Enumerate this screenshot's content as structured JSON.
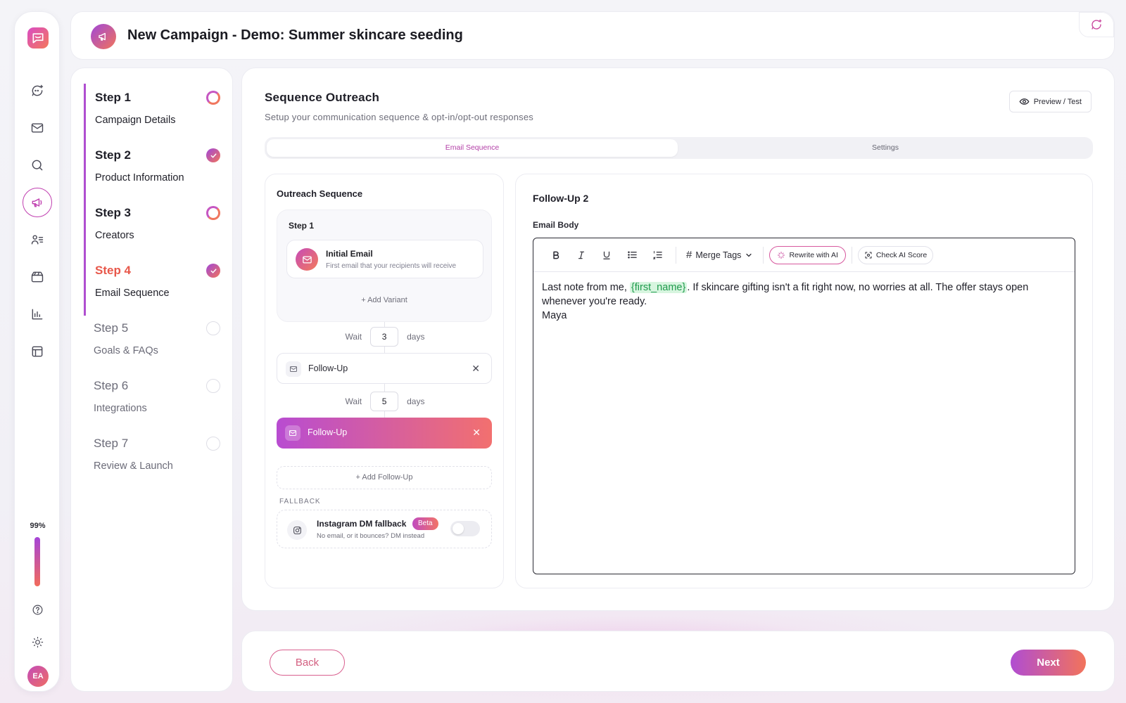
{
  "header": {
    "title": "New Campaign - Demo: Summer skincare seeding"
  },
  "rail": {
    "progress_label": "99%",
    "progress": 0.99,
    "avatar_initials": "EA"
  },
  "steps": [
    {
      "number": "Step 1",
      "name": "Campaign Details",
      "state": "in-progress"
    },
    {
      "number": "Step 2",
      "name": "Product Information",
      "state": "done"
    },
    {
      "number": "Step 3",
      "name": "Creators",
      "state": "in-progress"
    },
    {
      "number": "Step 4",
      "name": "Email Sequence",
      "state": "current"
    },
    {
      "number": "Step 5",
      "name": "Goals & FAQs",
      "state": "pending"
    },
    {
      "number": "Step 6",
      "name": "Integrations",
      "state": "pending"
    },
    {
      "number": "Step 7",
      "name": "Review & Launch",
      "state": "pending"
    }
  ],
  "main": {
    "title": "Sequence Outreach",
    "subtitle": "Setup your communication sequence & opt-in/opt-out responses",
    "preview_label": "Preview / Test",
    "tabs": [
      {
        "label": "Email Sequence",
        "active": true
      },
      {
        "label": "Settings",
        "active": false
      }
    ]
  },
  "sequence": {
    "title": "Outreach Sequence",
    "step_label": "Step 1",
    "initial": {
      "title": "Initial Email",
      "desc": "First email that your recipients will receive"
    },
    "add_variant": "+ Add Variant",
    "wait_label": "Wait",
    "days_label": "days",
    "wait1": "3",
    "wait2": "5",
    "followups": [
      {
        "label": "Follow-Up",
        "active": false
      },
      {
        "label": "Follow-Up",
        "active": true
      }
    ],
    "add_followup": "+ Add Follow-Up",
    "fallback": {
      "section_label": "FALLBACK",
      "title": "Instagram DM fallback",
      "badge": "Beta",
      "desc": "No email, or it bounces? DM instead",
      "enabled": false
    }
  },
  "editor": {
    "title": "Follow-Up 2",
    "body_label": "Email Body",
    "toolbar": {
      "merge_tags": "Merge Tags",
      "rewrite": "Rewrite with AI",
      "check": "Check AI Score"
    },
    "body": {
      "pre": "Last note from me, ",
      "tag": "{first_name}",
      "post": ". If skincare gifting isn't a fit right now, no worries at all. The offer stays open whenever you're ready.",
      "signature": "Maya"
    }
  },
  "footer": {
    "back": "Back",
    "next": "Next"
  },
  "colors": {
    "accent_start": "#b04dd2",
    "accent_end": "#f2735b",
    "merge_tag_bg": "#d7f5df"
  }
}
